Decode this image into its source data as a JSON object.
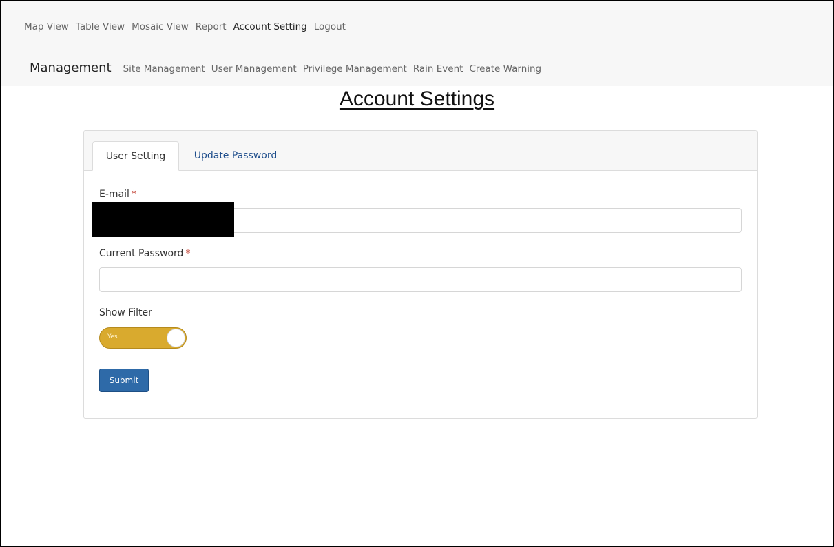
{
  "nav": {
    "items": [
      {
        "label": "Map View"
      },
      {
        "label": "Table View"
      },
      {
        "label": "Mosaic View"
      },
      {
        "label": "Report"
      },
      {
        "label": "Account Setting"
      },
      {
        "label": "Logout"
      }
    ]
  },
  "management": {
    "brand": "Management",
    "items": [
      {
        "label": "Site Management"
      },
      {
        "label": "User Management"
      },
      {
        "label": "Privilege Management"
      },
      {
        "label": "Rain Event"
      },
      {
        "label": "Create Warning"
      }
    ]
  },
  "page": {
    "title": "Account Settings"
  },
  "tabs": [
    {
      "label": "User Setting",
      "active": true
    },
    {
      "label": "Update Password",
      "active": false
    }
  ],
  "form": {
    "email": {
      "label": "E-mail",
      "required_mark": "*",
      "value": ""
    },
    "current_password": {
      "label": "Current Password",
      "required_mark": "*",
      "value": ""
    },
    "show_filter": {
      "label": "Show Filter",
      "toggle_text": "Yes",
      "on": true
    },
    "submit_label": "Submit"
  },
  "colors": {
    "toggle_on": "#d9aa2e",
    "submit_bg": "#2e6aa8",
    "tab_link": "#1f4e8c",
    "required": "#c0392b"
  }
}
